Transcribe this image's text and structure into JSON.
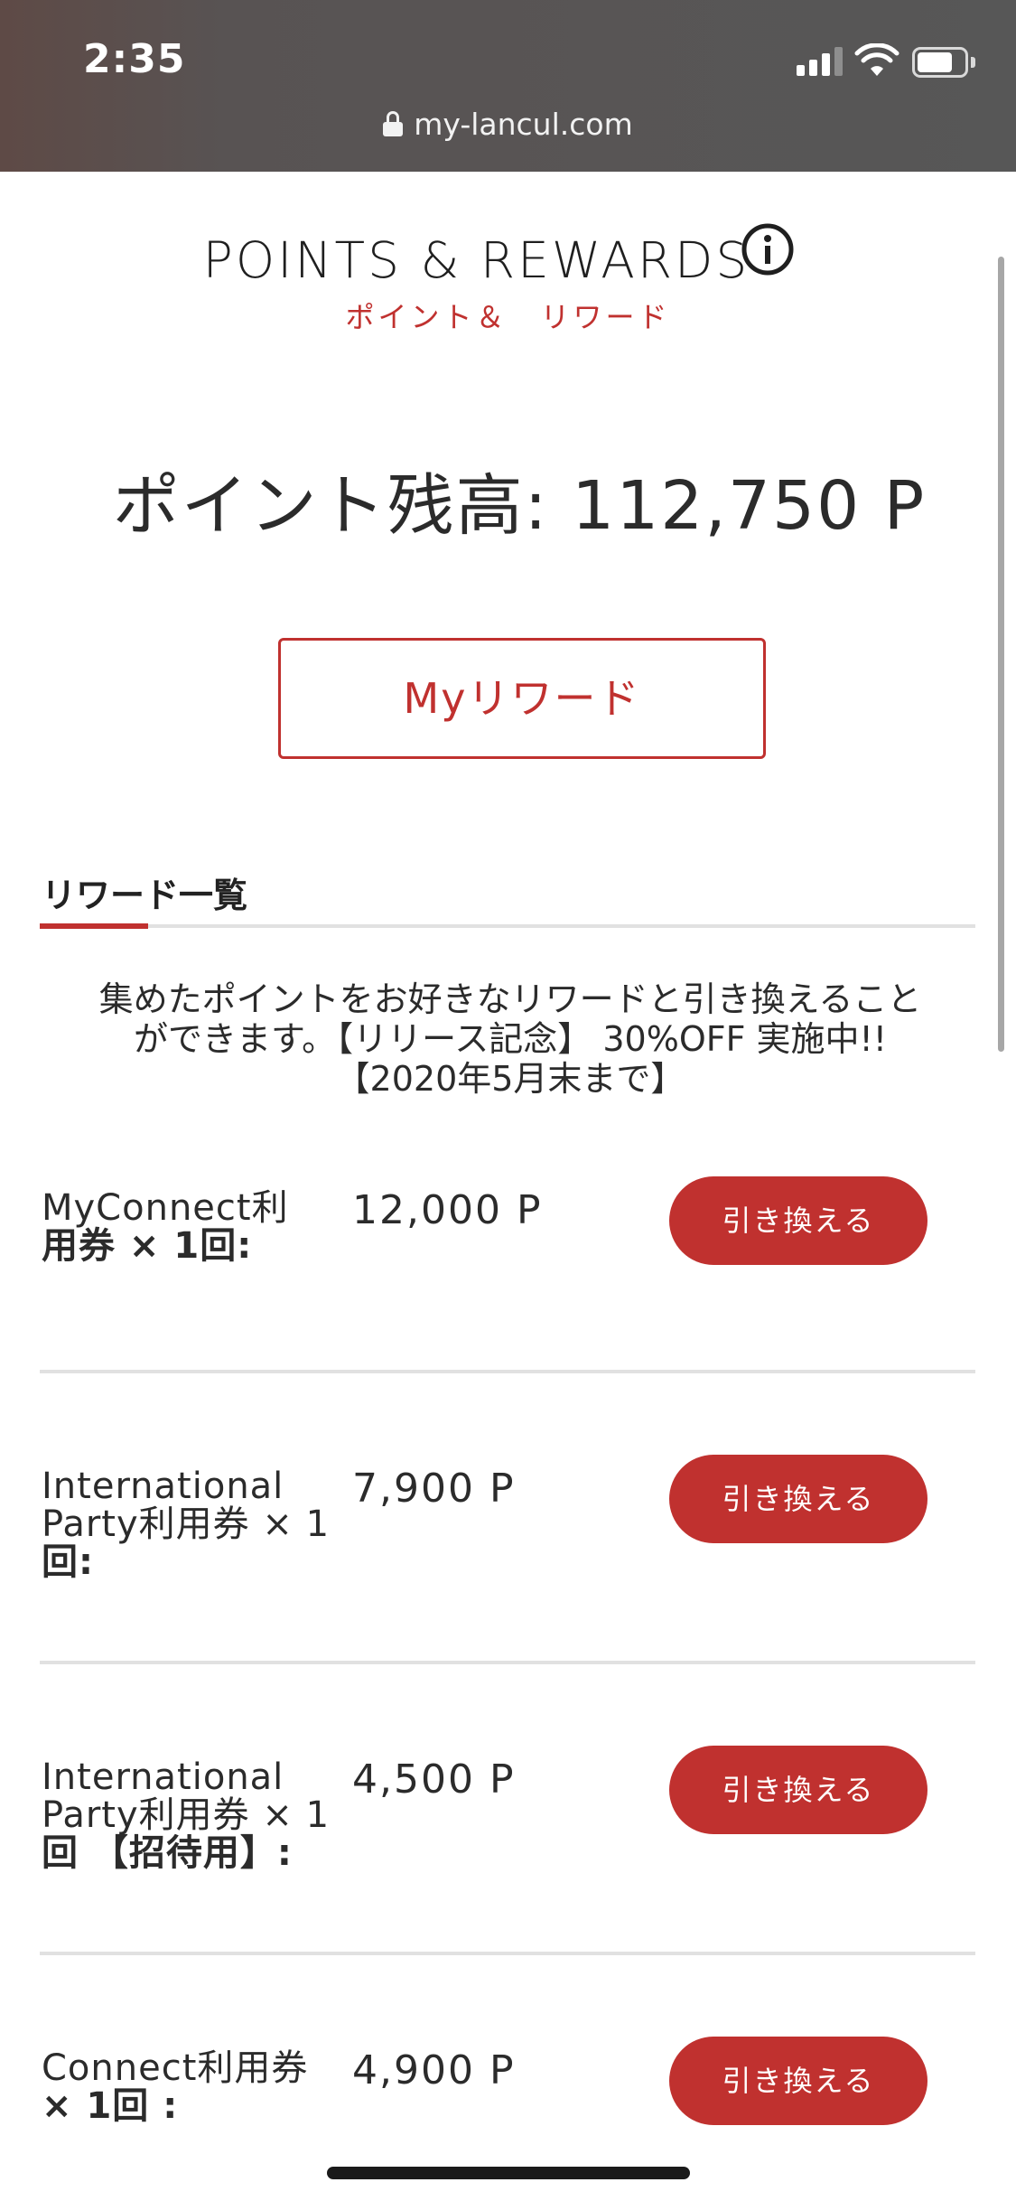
{
  "status_bar": {
    "time": "2:35",
    "url": "my-lancul.com"
  },
  "header": {
    "title": "POINTS & REWARDS",
    "subtitle": "ポイント＆　リワード"
  },
  "balance": {
    "text": "ポイント残高: 112,750 P"
  },
  "my_rewards_button": "Myリワード",
  "tab": {
    "label": "リワード一覧"
  },
  "notice": {
    "line1": "集めたポイントをお好きなリワードと引き換えること",
    "line2": "ができます。【リリース記念】 30%OFF 実施中!!",
    "line3": "【2020年5月末まで】"
  },
  "rewards": [
    {
      "name_line1": "MyConnect利",
      "name_line2": "用券 × 1回:",
      "name_line3": "",
      "points": "12,000 P",
      "action": "引き換える"
    },
    {
      "name_line1": "International",
      "name_line2": "Party利用券 × 1",
      "name_line3": "回:",
      "points": "7,900 P",
      "action": "引き換える"
    },
    {
      "name_line1": "International",
      "name_line2": "Party利用券 × 1",
      "name_line3": "回 【招待用】:",
      "points": "4,500 P",
      "action": "引き換える"
    },
    {
      "name_line1": "Connect利用券",
      "name_line2": "× 1回 :",
      "name_line3": "",
      "points": "4,900 P",
      "action": "引き換える"
    }
  ],
  "colors": {
    "accent": "#c0312f",
    "chrome": "#575757",
    "divider": "#e1e1e1"
  }
}
